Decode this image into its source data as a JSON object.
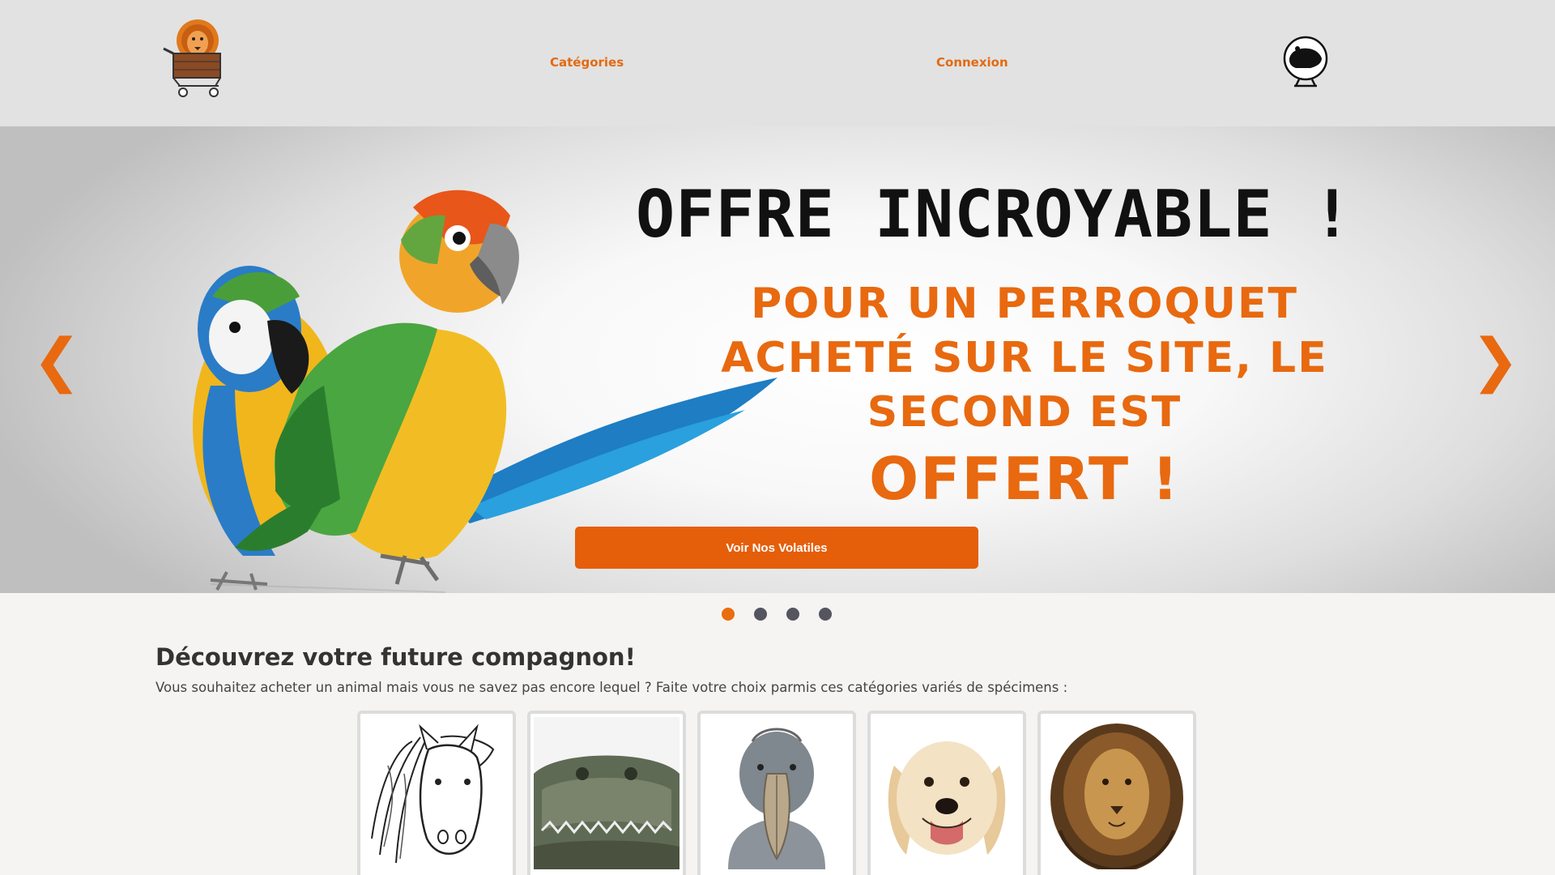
{
  "header": {
    "nav": [
      {
        "label": "Catégories"
      },
      {
        "label": "Connexion"
      }
    ]
  },
  "hero": {
    "title": "OFFRE INCROYABLE !",
    "subtitle_lines": [
      "POUR UN PERROQUET",
      "ACHETÉ SUR LE SITE, LE",
      "SECOND EST"
    ],
    "offert": "OFFERT !",
    "button_label": "Voir Nos Volatiles",
    "prev": "❮",
    "next": "❯",
    "slides_count": 4,
    "active_slide": 1
  },
  "discover": {
    "title": "Découvrez votre future compagnon!",
    "text": "Vous souhaitez acheter un animal mais vous ne savez pas encore lequel ? Faite votre choix parmis ces catégories variés de spécimens :",
    "categories": [
      {
        "icon": "horse-icon"
      },
      {
        "icon": "crocodile-icon"
      },
      {
        "icon": "shoebill-bird-icon"
      },
      {
        "icon": "dog-icon"
      },
      {
        "icon": "lion-icon"
      }
    ]
  },
  "colors": {
    "accent": "#e8690f",
    "header_bg": "#e2e2e2",
    "page_bg": "#f5f4f2",
    "button_bg": "#e55e0a",
    "dot": "#55555f"
  }
}
